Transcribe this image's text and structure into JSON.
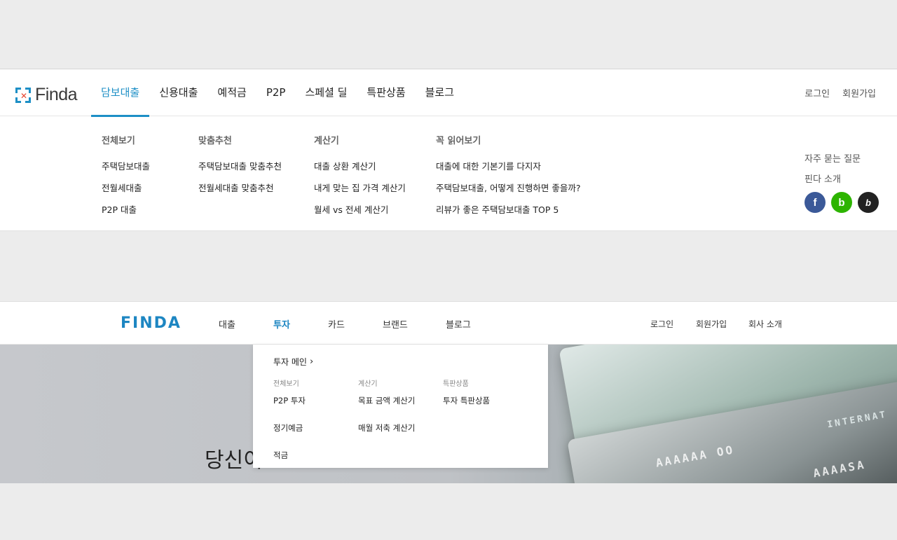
{
  "v1": {
    "logo": "Finda",
    "menu": [
      {
        "label": "담보대출",
        "active": true
      },
      {
        "label": "신용대출"
      },
      {
        "label": "예적금"
      },
      {
        "label": "P2P"
      },
      {
        "label": "스페셜 딜"
      },
      {
        "label": "특판상품"
      },
      {
        "label": "블로그"
      }
    ],
    "login": "로그인",
    "signup": "회원가입",
    "columns": [
      {
        "header": "전체보기",
        "items": [
          "주택담보대출",
          "전월세대출",
          "P2P 대출"
        ]
      },
      {
        "header": "맞춤추천",
        "items": [
          "주택담보대출 맞춤추천",
          "전월세대출 맞춤추천"
        ]
      },
      {
        "header": "계산기",
        "items": [
          "대출 상환 계산기",
          "내게 맞는 집 가격 계산기",
          "월세 vs 전세 계산기"
        ]
      },
      {
        "header": "꼭 읽어보기",
        "items": [
          "대출에 대한 기본기를 다지자",
          "주택담보대출, 어떻게 진행하면 좋을까?",
          "리뷰가 좋은 주택담보대출 TOP 5"
        ]
      }
    ],
    "side": [
      "자주 묻는 질문",
      "핀다 소개"
    ],
    "social": [
      {
        "name": "facebook",
        "glyph": "f",
        "color": "#3b5998"
      },
      {
        "name": "naver-blog",
        "glyph": "b",
        "color": "#2db400"
      },
      {
        "name": "brunch",
        "glyph": "b",
        "color": "#222222"
      }
    ],
    "accent": "#1d8fc6"
  },
  "v2": {
    "logo": "FINDA",
    "menu": [
      {
        "label": "대출"
      },
      {
        "label": "투자",
        "active": true
      },
      {
        "label": "카드"
      },
      {
        "label": "브랜드"
      },
      {
        "label": "블로그"
      }
    ],
    "login": "로그인",
    "signup": "회원가입",
    "about": "회사 소개",
    "dropdown": {
      "main_link": "투자 메인",
      "columns": [
        {
          "header": "전체보기",
          "items": [
            "P2P 투자",
            "정기예금",
            "적금"
          ]
        },
        {
          "header": "계산기",
          "items": [
            "목표 금액 계산기",
            "매월 저축 계산기"
          ]
        },
        {
          "header": "특판상품",
          "items": [
            "투자 특판상품"
          ]
        }
      ]
    },
    "hero_text": "당신이",
    "card_text": [
      "INTERNAT",
      "AAAAAA OO",
      "AAAASA"
    ],
    "accent": "#1d86c2"
  }
}
